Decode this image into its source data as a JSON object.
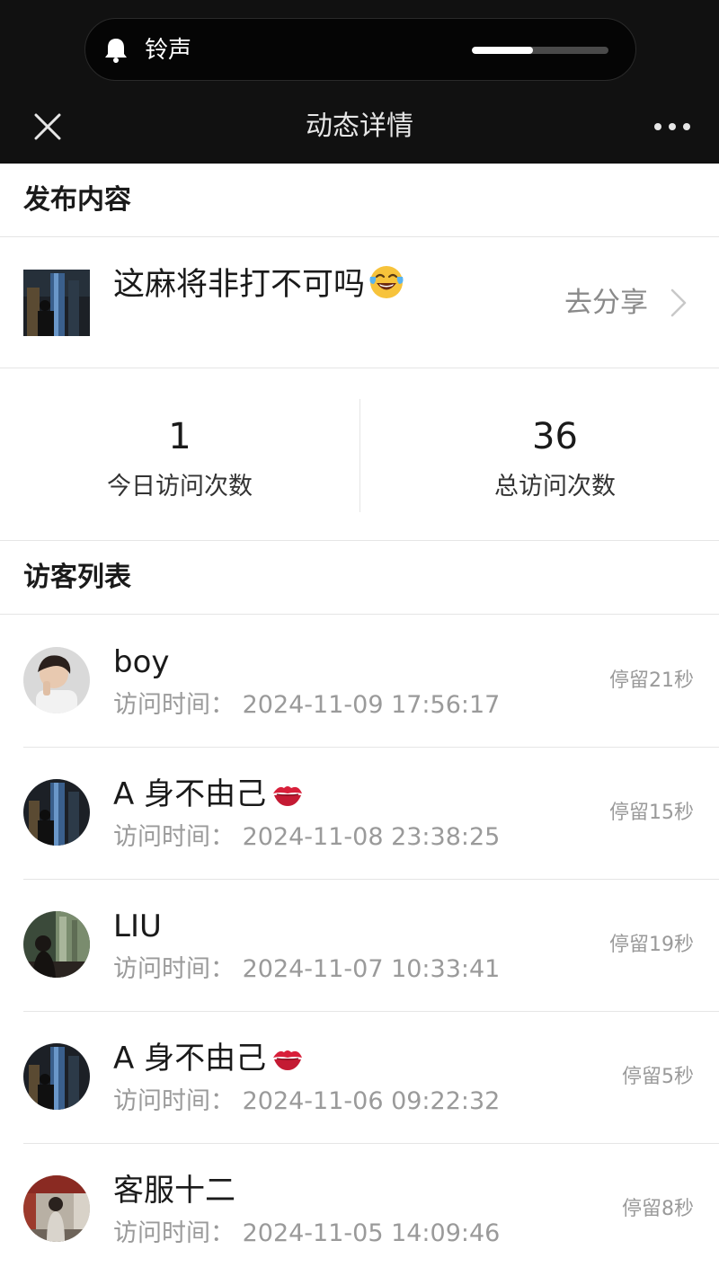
{
  "status": {
    "ring_label": "铃声",
    "volume_percent": 45
  },
  "nav": {
    "title": "动态详情",
    "close_icon": "close-icon",
    "more_icon": "more-icon"
  },
  "post_section": {
    "header": "发布内容",
    "text": "这麻将非打不可吗",
    "emoji": "face-with-tears-of-joy-emoji",
    "share_label": "去分享"
  },
  "stats": {
    "today_value": "1",
    "today_label": "今日访问次数",
    "total_value": "36",
    "total_label": "总访问次数"
  },
  "visitors_section": {
    "header": "访客列表",
    "time_prefix": "访问时间：",
    "items": [
      {
        "name": "boy",
        "name_emoji": "",
        "time": "访问时间：  2024-11-09 17:56:17",
        "stay": "停留21秒"
      },
      {
        "name": "A 身不由己",
        "name_emoji": "kiss-mark-emoji",
        "time": "访问时间：  2024-11-08 23:38:25",
        "stay": "停留15秒"
      },
      {
        "name": "LIU",
        "name_emoji": "",
        "time": "访问时间：  2024-11-07 10:33:41",
        "stay": "停留19秒"
      },
      {
        "name": "A 身不由己",
        "name_emoji": "kiss-mark-emoji",
        "time": "访问时间：  2024-11-06 09:22:32",
        "stay": "停留5秒"
      },
      {
        "name": "客服十二",
        "name_emoji": "",
        "time": "访问时间：  2024-11-05 14:09:46",
        "stay": "停留8秒"
      }
    ]
  }
}
